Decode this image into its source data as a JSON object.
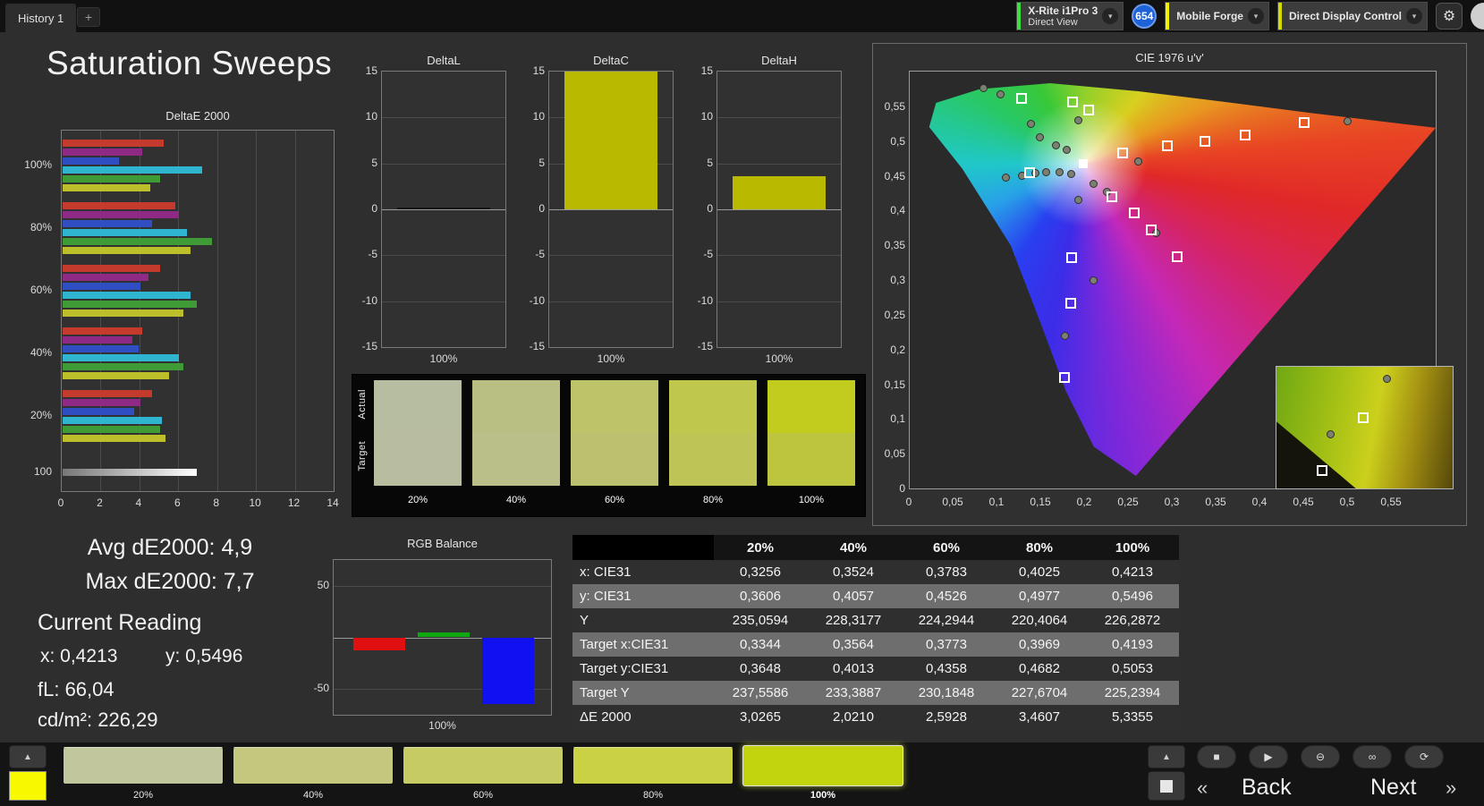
{
  "title": "Saturation Sweeps",
  "topbar": {
    "history_tab": "History 1",
    "add_tab_label": "+",
    "meter": {
      "line1": "X-Rite i1Pro 3",
      "line2": "Direct View",
      "accent": "#3ce03c"
    },
    "reading_count": "654",
    "badge_color": "#1e62d8",
    "source": {
      "label": "Mobile Forge",
      "accent": "#f2f200"
    },
    "control": {
      "label": "Direct Display Control",
      "accent": "#d2dc00"
    },
    "chevron_glyph": "▾",
    "gear_glyph": "⚙"
  },
  "readings": {
    "avg": "Avg dE2000: 4,9",
    "max": "Max dE2000: 7,7",
    "current_heading": "Current Reading",
    "x": "x: 0,4213",
    "y": "y: 0,5496",
    "fl": "fL: 66,04",
    "cdm2": "cd/m²: 226,29"
  },
  "swatch_panel": {
    "row_labels": [
      "Actual",
      "Target"
    ],
    "columns": [
      {
        "label": "20%",
        "actual": "#b7bda1",
        "target": "#b9bd9f"
      },
      {
        "label": "40%",
        "actual": "#b9bf83",
        "target": "#babe89"
      },
      {
        "label": "60%",
        "actual": "#bcc368",
        "target": "#bcc170"
      },
      {
        "label": "80%",
        "actual": "#bfc84c",
        "target": "#bec455"
      },
      {
        "label": "100%",
        "actual": "#c1cc1e",
        "target": "#bdc53f"
      }
    ]
  },
  "table": {
    "columns": [
      "20%",
      "40%",
      "60%",
      "80%",
      "100%"
    ],
    "rows": [
      {
        "label": "x: CIE31",
        "values": [
          "0,3256",
          "0,3524",
          "0,3783",
          "0,4025",
          "0,4213"
        ]
      },
      {
        "label": "y: CIE31",
        "values": [
          "0,3606",
          "0,4057",
          "0,4526",
          "0,4977",
          "0,5496"
        ]
      },
      {
        "label": "Y",
        "values": [
          "235,0594",
          "228,3177",
          "224,2944",
          "220,4064",
          "226,2872"
        ]
      },
      {
        "label": "Target x:CIE31",
        "values": [
          "0,3344",
          "0,3564",
          "0,3773",
          "0,3969",
          "0,4193"
        ]
      },
      {
        "label": "Target y:CIE31",
        "values": [
          "0,3648",
          "0,4013",
          "0,4358",
          "0,4682",
          "0,5053"
        ]
      },
      {
        "label": "Target Y",
        "values": [
          "237,5586",
          "233,3887",
          "230,1848",
          "227,6704",
          "225,2394"
        ]
      },
      {
        "label": "ΔE 2000",
        "values": [
          "3,0265",
          "2,0210",
          "2,5928",
          "3,4607",
          "5,3355"
        ]
      }
    ]
  },
  "bottombar": {
    "peek_swatch_color": "#f8f800",
    "up_glyph": "▲",
    "swatches": [
      {
        "label": "20%",
        "color": "#c2c69c",
        "selected": false
      },
      {
        "label": "40%",
        "color": "#c4c87f",
        "selected": false
      },
      {
        "label": "60%",
        "color": "#c7cb63",
        "selected": false
      },
      {
        "label": "80%",
        "color": "#cbd145",
        "selected": false
      },
      {
        "label": "100%",
        "color": "#c2d40e",
        "selected": true
      }
    ],
    "transport": [
      {
        "name": "stop",
        "glyph": "■"
      },
      {
        "name": "play",
        "glyph": "▶"
      },
      {
        "name": "single-measure",
        "glyph": "⊖"
      },
      {
        "name": "continuous-measure",
        "glyph": "∞"
      },
      {
        "name": "refresh",
        "glyph": "⟳"
      }
    ],
    "prev_glyph": "«",
    "back_label": "Back",
    "next_label": "Next",
    "fwd_glyph": "»"
  },
  "chart_data": [
    {
      "id": "deltae2000",
      "type": "bar",
      "orientation": "horizontal",
      "title": "DeltaE 2000",
      "xlabel": "",
      "ylabel": "",
      "xlim": [
        0,
        14
      ],
      "xticks": [
        0,
        2,
        4,
        6,
        8,
        10,
        12,
        14
      ],
      "groups": [
        {
          "label": "100%",
          "bars": [
            {
              "color": "#c43a2c",
              "value": 5.2
            },
            {
              "color": "#8e2a86",
              "value": 4.1
            },
            {
              "color": "#2f4ec2",
              "value": 2.9
            },
            {
              "color": "#2fb5cf",
              "value": 7.2
            },
            {
              "color": "#3f9b35",
              "value": 5.0
            },
            {
              "color": "#bcbf2a",
              "value": 4.5
            }
          ]
        },
        {
          "label": "80%",
          "bars": [
            {
              "color": "#c43a2c",
              "value": 5.8
            },
            {
              "color": "#8e2a86",
              "value": 6.0
            },
            {
              "color": "#2f4ec2",
              "value": 4.6
            },
            {
              "color": "#2fb5cf",
              "value": 6.4
            },
            {
              "color": "#3f9b35",
              "value": 7.7
            },
            {
              "color": "#bcbf2a",
              "value": 6.6
            }
          ]
        },
        {
          "label": "60%",
          "bars": [
            {
              "color": "#c43a2c",
              "value": 5.0
            },
            {
              "color": "#8e2a86",
              "value": 4.4
            },
            {
              "color": "#2f4ec2",
              "value": 4.0
            },
            {
              "color": "#2fb5cf",
              "value": 6.6
            },
            {
              "color": "#3f9b35",
              "value": 6.9
            },
            {
              "color": "#bcbf2a",
              "value": 6.2
            }
          ]
        },
        {
          "label": "40%",
          "bars": [
            {
              "color": "#c43a2c",
              "value": 4.1
            },
            {
              "color": "#8e2a86",
              "value": 3.6
            },
            {
              "color": "#2f4ec2",
              "value": 3.9
            },
            {
              "color": "#2fb5cf",
              "value": 6.0
            },
            {
              "color": "#3f9b35",
              "value": 6.2
            },
            {
              "color": "#bcbf2a",
              "value": 5.5
            }
          ]
        },
        {
          "label": "20%",
          "bars": [
            {
              "color": "#c43a2c",
              "value": 4.6
            },
            {
              "color": "#8e2a86",
              "value": 4.0
            },
            {
              "color": "#2f4ec2",
              "value": 3.7
            },
            {
              "color": "#2fb5cf",
              "value": 5.1
            },
            {
              "color": "#3f9b35",
              "value": 5.0
            },
            {
              "color": "#bcbf2a",
              "value": 5.3
            }
          ]
        },
        {
          "label": "100",
          "bars": [
            {
              "color": "white-gradient",
              "value": 6.9
            }
          ]
        }
      ]
    },
    {
      "id": "deltaL",
      "type": "bar",
      "title": "DeltaL",
      "category": "100%",
      "ylim": [
        -15,
        15
      ],
      "yticks": [
        15,
        10,
        5,
        0,
        -5,
        -10,
        -15
      ],
      "value": 0.2,
      "color": "#161616"
    },
    {
      "id": "deltaC",
      "type": "bar",
      "title": "DeltaC",
      "category": "100%",
      "ylim": [
        -15,
        15
      ],
      "yticks": [
        15,
        10,
        5,
        0,
        -5,
        -10,
        -15
      ],
      "value": 15,
      "color": "#b9ba00"
    },
    {
      "id": "deltaH",
      "type": "bar",
      "title": "DeltaH",
      "category": "100%",
      "ylim": [
        -15,
        15
      ],
      "yticks": [
        15,
        10,
        5,
        0,
        -5,
        -10,
        -15
      ],
      "value": 3.6,
      "color": "#b9ba00"
    },
    {
      "id": "rgb_balance",
      "type": "bar",
      "title": "RGB Balance",
      "category": "100%",
      "ylim": [
        -75,
        75
      ],
      "yticks": [
        50,
        -50
      ],
      "series": [
        {
          "name": "red",
          "value": -13,
          "color": "#e01010"
        },
        {
          "name": "green",
          "value": 5,
          "color": "#10a810"
        },
        {
          "name": "blue",
          "value": -65,
          "color": "#1010f0"
        }
      ]
    },
    {
      "id": "cie",
      "type": "scatter",
      "title": "CIE 1976 u'v'",
      "xlim": [
        0,
        0.6
      ],
      "ylim": [
        0,
        0.6
      ],
      "tick_values": [
        0,
        0.05,
        0.1,
        0.15,
        0.2,
        0.25,
        0.3,
        0.35,
        0.4,
        0.45,
        0.5,
        0.55
      ],
      "tick_labels": [
        "0",
        "0,05",
        "0,1",
        "0,15",
        "0,2",
        "0,25",
        "0,3",
        "0,35",
        "0,4",
        "0,45",
        "0,5",
        "0,55"
      ],
      "white_point": [
        0.198,
        0.468
      ],
      "targets": [
        [
          0.128,
          0.562
        ],
        [
          0.186,
          0.556
        ],
        [
          0.204,
          0.545
        ],
        [
          0.243,
          0.483
        ],
        [
          0.294,
          0.493
        ],
        [
          0.337,
          0.5
        ],
        [
          0.383,
          0.508
        ],
        [
          0.45,
          0.526
        ],
        [
          0.137,
          0.454
        ],
        [
          0.231,
          0.42
        ],
        [
          0.256,
          0.396
        ],
        [
          0.275,
          0.372
        ],
        [
          0.305,
          0.334
        ],
        [
          0.185,
          0.332
        ],
        [
          0.184,
          0.266
        ],
        [
          0.177,
          0.16
        ]
      ],
      "measurements": [
        [
          0.084,
          0.576
        ],
        [
          0.104,
          0.567
        ],
        [
          0.138,
          0.525
        ],
        [
          0.192,
          0.53
        ],
        [
          0.148,
          0.506
        ],
        [
          0.167,
          0.494
        ],
        [
          0.179,
          0.487
        ],
        [
          0.11,
          0.447
        ],
        [
          0.128,
          0.45
        ],
        [
          0.143,
          0.454
        ],
        [
          0.156,
          0.455
        ],
        [
          0.171,
          0.455
        ],
        [
          0.184,
          0.452
        ],
        [
          0.21,
          0.439
        ],
        [
          0.225,
          0.427
        ],
        [
          0.261,
          0.471
        ],
        [
          0.192,
          0.415
        ],
        [
          0.281,
          0.367
        ],
        [
          0.21,
          0.3
        ],
        [
          0.177,
          0.22
        ],
        [
          0.499,
          0.529
        ]
      ],
      "inset": {
        "circles": [
          [
            63,
            10
          ],
          [
            31,
            56
          ]
        ],
        "squares": [
          [
            49,
            42
          ],
          [
            26,
            85
          ]
        ]
      }
    }
  ]
}
